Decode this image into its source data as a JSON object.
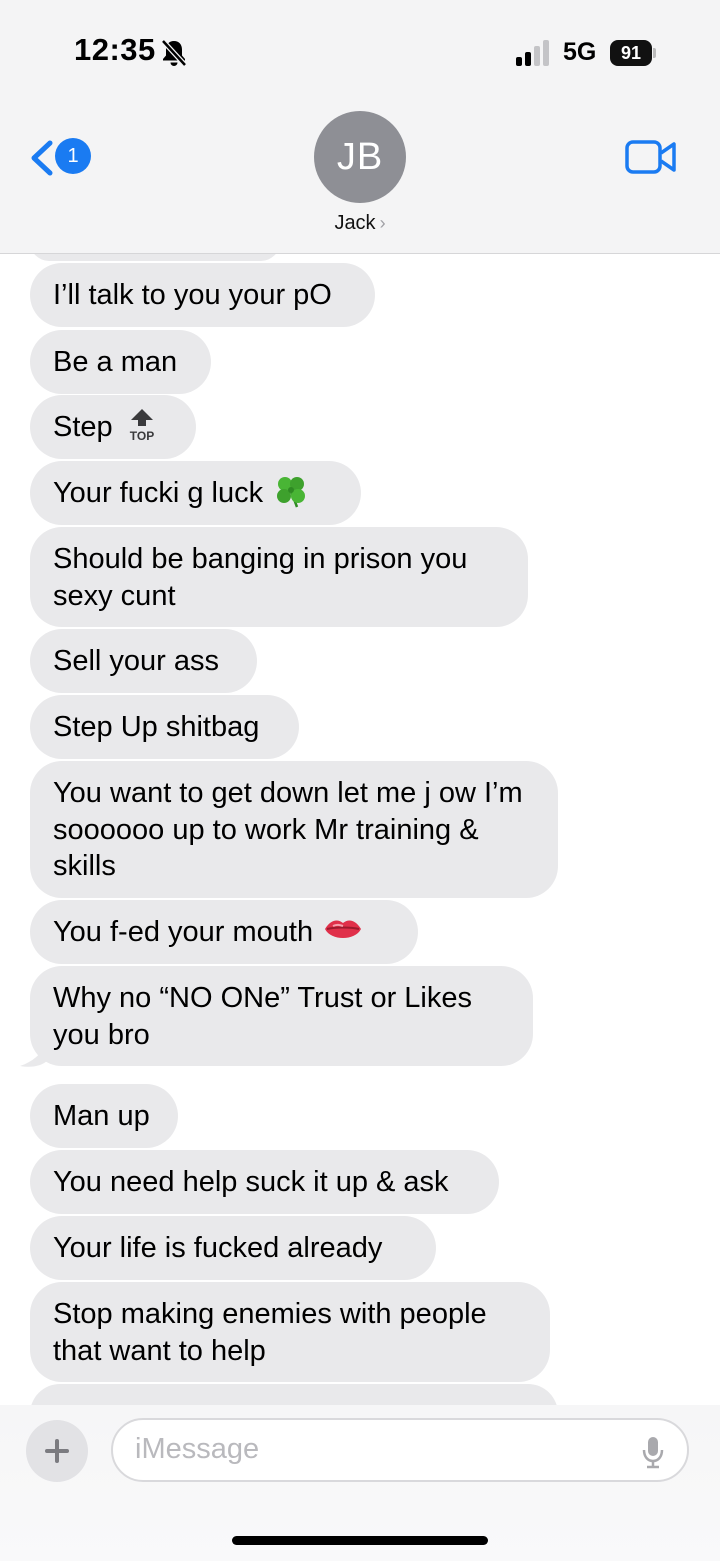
{
  "status_bar": {
    "time": "12:35",
    "network": "5G",
    "battery": "91"
  },
  "header": {
    "back_badge": "1",
    "avatar_initials": "JB",
    "contact_name": "Jack",
    "contact_chevron": "›"
  },
  "messages": [
    {
      "text": "I’ll talk to you your pO"
    },
    {
      "text": "Be a man"
    },
    {
      "text": "Step"
    },
    {
      "text": "Your fucki g luck"
    },
    {
      "text": "Should be banging in prison you sexy cunt"
    },
    {
      "text": "Sell your ass"
    },
    {
      "text": "Step Up shitbag"
    },
    {
      "text": "You want to get down let me j ow I’m soooooo up to work Mr training & skills"
    },
    {
      "text": "You f-ed your mouth"
    },
    {
      "text": "Why no “NO ONe” Trust or Likes you bro"
    },
    {
      "text": "Man up"
    },
    {
      "text": "You need help suck it up & ask"
    },
    {
      "text": "Your life is fucked already"
    },
    {
      "text": "Stop making enemies with people that want to help"
    }
  ],
  "emoji": {
    "top_label": "TOP"
  },
  "composer": {
    "placeholder": "iMessage"
  },
  "colors": {
    "accent": "#1a7bf2",
    "bubble": "#e9e9eb",
    "header_bg": "#f4f4f5"
  }
}
